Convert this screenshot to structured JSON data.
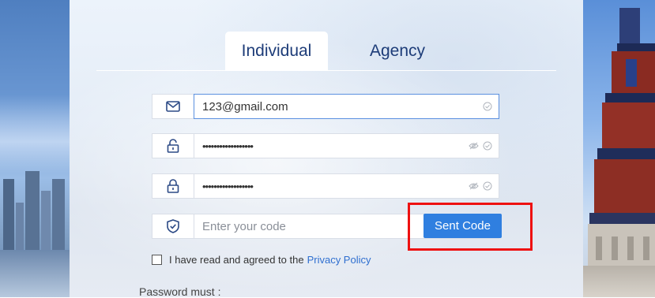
{
  "tabs": [
    {
      "label": "Individual",
      "active": true
    },
    {
      "label": "Agency",
      "active": false
    }
  ],
  "fields": {
    "email": {
      "value": "123@gmail.com",
      "icon": "mail-icon"
    },
    "password": {
      "value": "••••••••••••••••••",
      "icon": "unlock-icon"
    },
    "confirm_password": {
      "value": "••••••••••••••••••",
      "icon": "lock-icon"
    },
    "code": {
      "placeholder": "Enter your code",
      "icon": "shield-check-icon"
    }
  },
  "buttons": {
    "send_code": "Sent Code"
  },
  "agreement": {
    "text": "I have read and agreed to the",
    "link": "Privacy Policy"
  },
  "password_rules_heading": "Password must :",
  "colors": {
    "accent": "#2f7fe0",
    "highlight": "#ee1111",
    "tab_text": "#1d3c78"
  }
}
